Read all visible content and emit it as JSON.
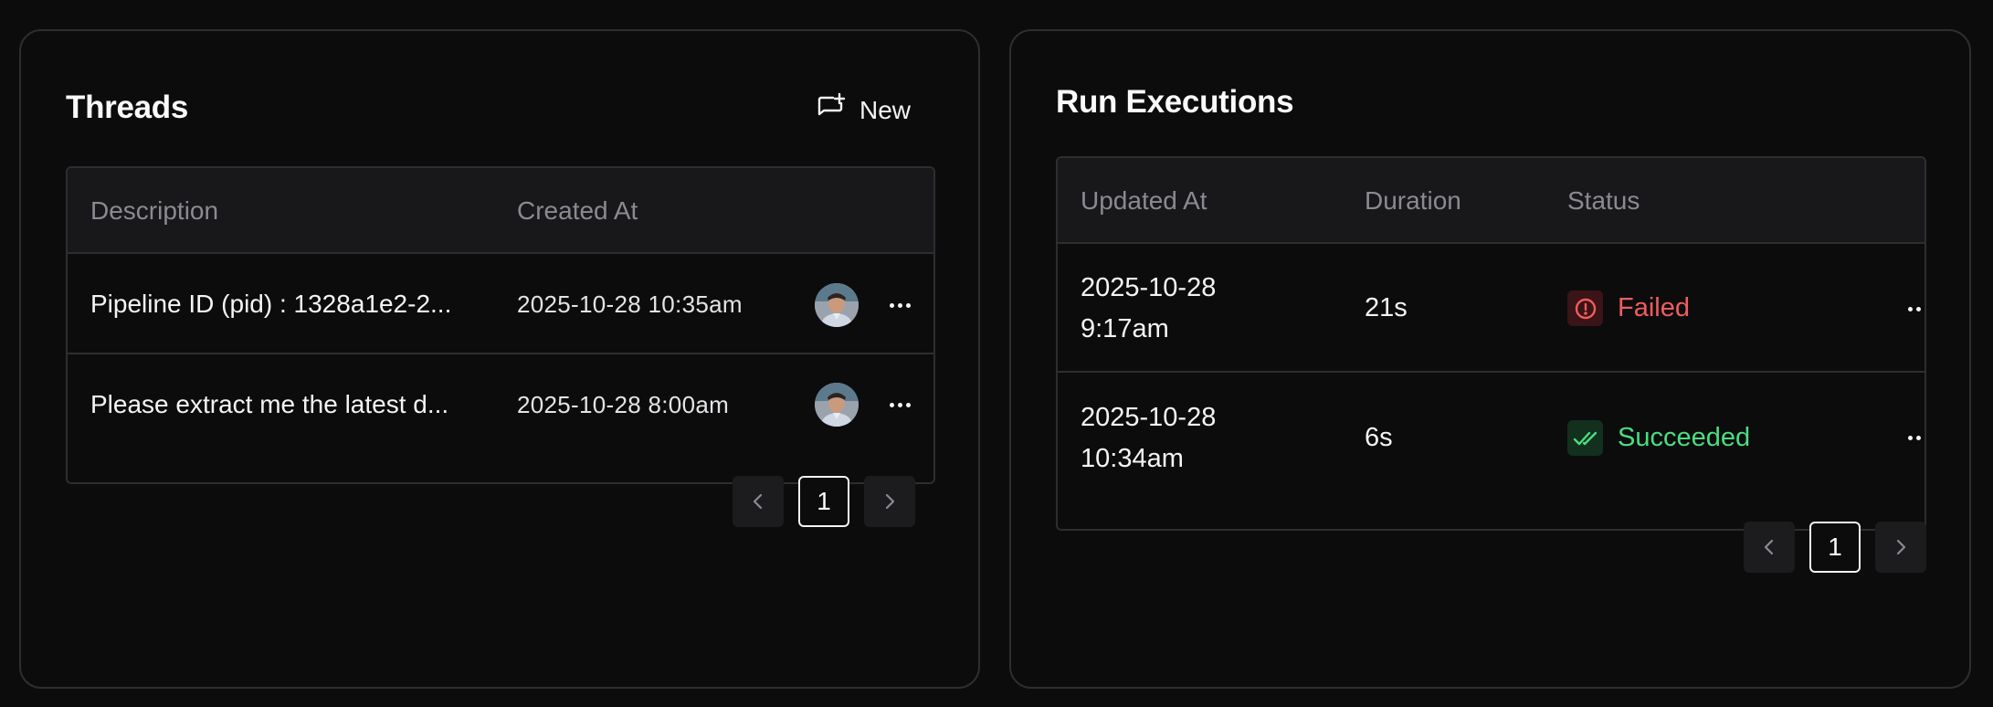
{
  "threads": {
    "title": "Threads",
    "new_label": "New",
    "columns": [
      "Description",
      "Created At"
    ],
    "rows": [
      {
        "description": "Pipeline ID (pid) : 1328a1e2-2...",
        "created_at": "2025-10-28 10:35am"
      },
      {
        "description": "Please extract me the latest d...",
        "created_at": "2025-10-28 8:00am"
      }
    ],
    "pagination": {
      "current": "1"
    }
  },
  "runs": {
    "title": "Run Executions",
    "columns": [
      "Updated At",
      "Duration",
      "Status"
    ],
    "rows": [
      {
        "date": "2025-10-28",
        "time": "9:17am",
        "duration": "21s",
        "status": "Failed",
        "status_color": "#f05d5e"
      },
      {
        "date": "2025-10-28",
        "time": "10:34am",
        "duration": "6s",
        "status": "Succeeded",
        "status_color": "#4ade80"
      }
    ],
    "pagination": {
      "current": "1"
    }
  },
  "colors": {
    "background": "#0c0c0d",
    "border": "#2e2e31",
    "header_bg": "#18181b",
    "failed": "#f05d5e",
    "succeeded": "#4ade80"
  },
  "icons": {
    "new": "message-plus-icon",
    "row_menu": "more-horizontal-icon",
    "failed": "alert-circle-icon",
    "succeeded": "check-check-icon",
    "prev": "chevron-left-icon",
    "next": "chevron-right-icon"
  }
}
